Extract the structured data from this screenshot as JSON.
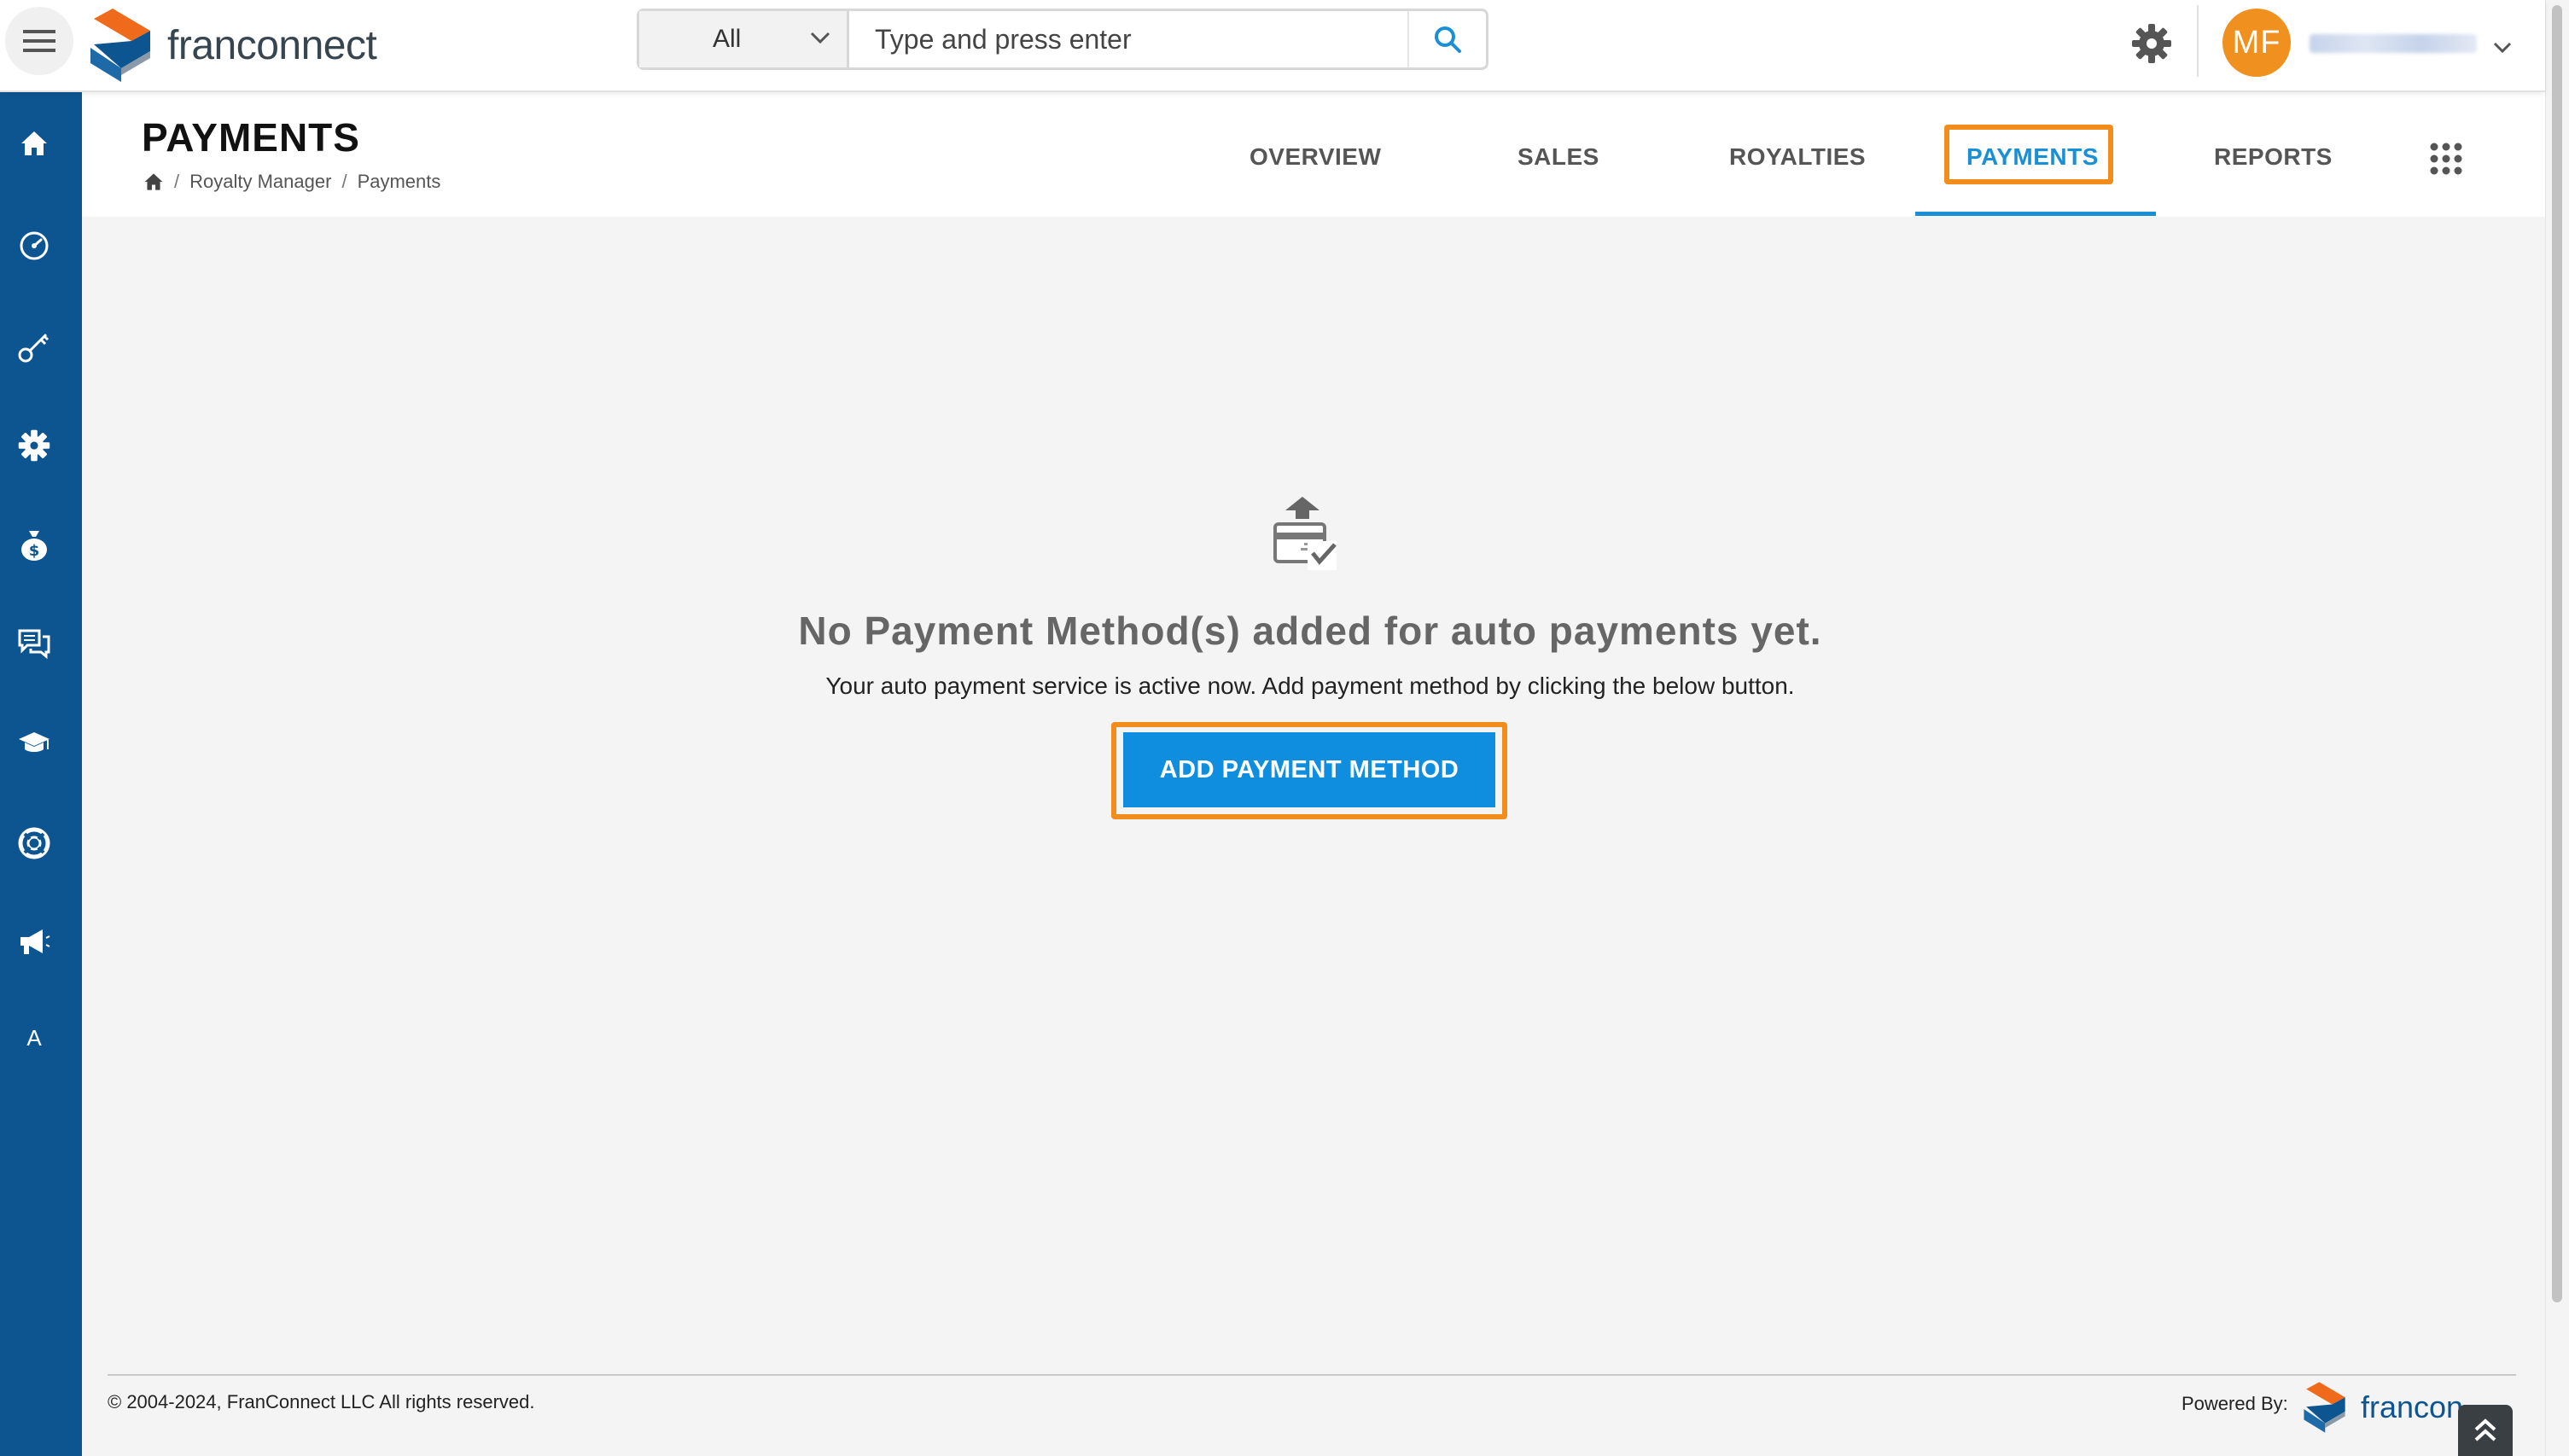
{
  "header": {
    "logo_text": "franconnect",
    "search": {
      "scope": "All",
      "placeholder": "Type and press enter"
    },
    "user_initials": "MF",
    "colors": {
      "avatar": "#f0901e",
      "accent": "#0f8ee0",
      "highlight": "#f28c1a"
    }
  },
  "sidebar": {
    "items": [
      {
        "icon": "home-icon"
      },
      {
        "icon": "dashboard-gauge-icon"
      },
      {
        "icon": "key-icon"
      },
      {
        "icon": "settings-gear-icon"
      },
      {
        "icon": "money-bag-icon"
      },
      {
        "icon": "chat-icon"
      },
      {
        "icon": "graduation-cap-icon"
      },
      {
        "icon": "support-lifebuoy-icon"
      },
      {
        "icon": "megaphone-icon"
      },
      {
        "letter": "A"
      }
    ],
    "color": "#0d5590"
  },
  "page": {
    "title": "PAYMENTS",
    "breadcrumb": [
      "Royalty Manager",
      "Payments"
    ]
  },
  "tabs": {
    "items": [
      "OVERVIEW",
      "SALES",
      "ROYALTIES",
      "PAYMENTS",
      "REPORTS"
    ],
    "active": "PAYMENTS"
  },
  "empty_state": {
    "title": "No Payment Method(s) added for auto payments yet.",
    "subtitle": "Your auto payment service is active now. Add payment method by clicking the below button.",
    "button": "ADD PAYMENT METHOD"
  },
  "footer": {
    "copyright": "© 2004-2024, FranConnect LLC All rights reserved.",
    "powered_by": "Powered By:",
    "logo_text": "francon"
  }
}
